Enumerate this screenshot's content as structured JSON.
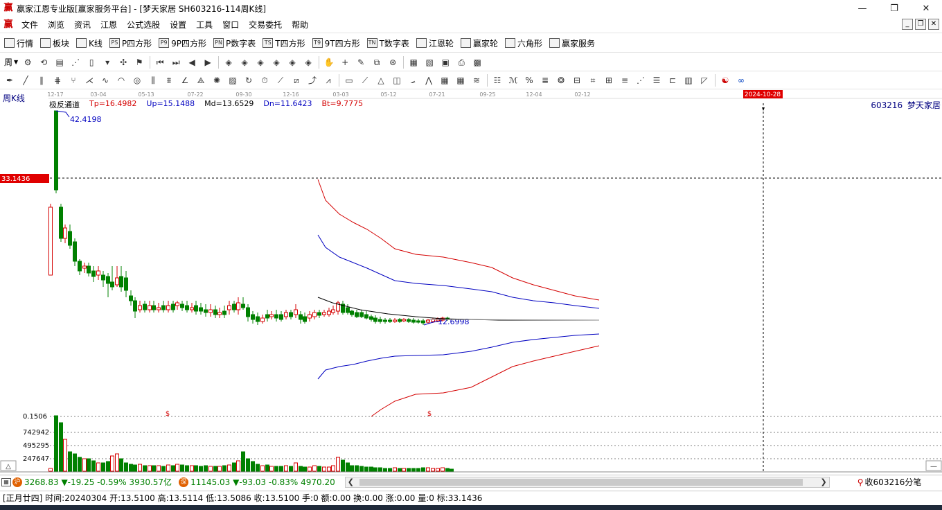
{
  "window": {
    "title": "赢家江恩专业版[赢家服务平台] - [梦天家居  SH603216-114周K线]",
    "app_logo": "赢",
    "controls": [
      "minimize-icon",
      "restore-icon",
      "close-icon"
    ]
  },
  "menu": {
    "items": [
      "文件",
      "浏览",
      "资讯",
      "江恩",
      "公式选股",
      "设置",
      "工具",
      "窗口",
      "交易委托",
      "帮助"
    ]
  },
  "toolbar1": {
    "items": [
      {
        "icon": "grid-icon",
        "label": "行情"
      },
      {
        "icon": "blocks-icon",
        "label": "板块"
      },
      {
        "icon": "kline-icon",
        "label": "K线"
      },
      {
        "icon": "ps-icon",
        "icon_text": "PS",
        "label": "P四方形"
      },
      {
        "icon": "p9-icon",
        "icon_text": "P9",
        "label": "9P四方形"
      },
      {
        "icon": "pn-icon",
        "icon_text": "PN",
        "label": "P数字表"
      },
      {
        "icon": "ts-icon",
        "icon_text": "TS",
        "label": "T四方形"
      },
      {
        "icon": "t9-icon",
        "icon_text": "T9",
        "label": "9T四方形"
      },
      {
        "icon": "tn-icon",
        "icon_text": "TN",
        "label": "T数字表"
      },
      {
        "icon": "spiral-icon",
        "label": "江恩轮"
      },
      {
        "icon": "wheel-icon",
        "label": "赢家轮"
      },
      {
        "icon": "hexagon-icon",
        "label": "六角形"
      },
      {
        "icon": "dollar-icon",
        "label": "赢家服务"
      }
    ]
  },
  "toolbar2": {
    "period_label": "周"
  },
  "chart": {
    "period_label": "周K线",
    "stock_code": "603216",
    "stock_name": "梦天家居",
    "date_marker": "2024-10-28",
    "price_marker": "33.1436",
    "high_label": "42.4198",
    "low_label": "12.6998",
    "x_ticks": [
      "12-17",
      "03-04",
      "05-13",
      "07-22",
      "09-30",
      "12-16",
      "03-03",
      "05-12",
      "07-21",
      "09-25",
      "12-04",
      "02-12"
    ],
    "indicator": {
      "name": "极反通道",
      "tp": "Tp=16.4982",
      "up": "Up=15.1488",
      "md": "Md=13.6529",
      "dn": "Dn=11.6423",
      "bt": "Bt=9.7775"
    },
    "volume_labels": [
      "0.1506",
      "742942",
      "495295",
      "247647"
    ],
    "dollar_marks": [
      "$",
      "$"
    ],
    "colors": {
      "up": "#d40000",
      "down": "#008000",
      "band_outer": "#d40000",
      "band_inner": "#0000c0",
      "mid": "#000000",
      "grid": "#000000"
    }
  },
  "status": {
    "sh_index": "3268.83 ▼-19.25 -0.59% 3930.57亿",
    "sz_index": "11145.03 ▼-93.03 -0.83% 4970.20",
    "sh_icon": "沪",
    "sz_icon": "深",
    "tick_button": "收603216分笔"
  },
  "bottom": {
    "info": "[正月廿四] 时间:20240304 开:13.5100 高:13.5114 低:13.5086 收:13.5100 手:0 额:0.00 换:0.00 涨:0.00 量:0 标:33.1436"
  }
}
